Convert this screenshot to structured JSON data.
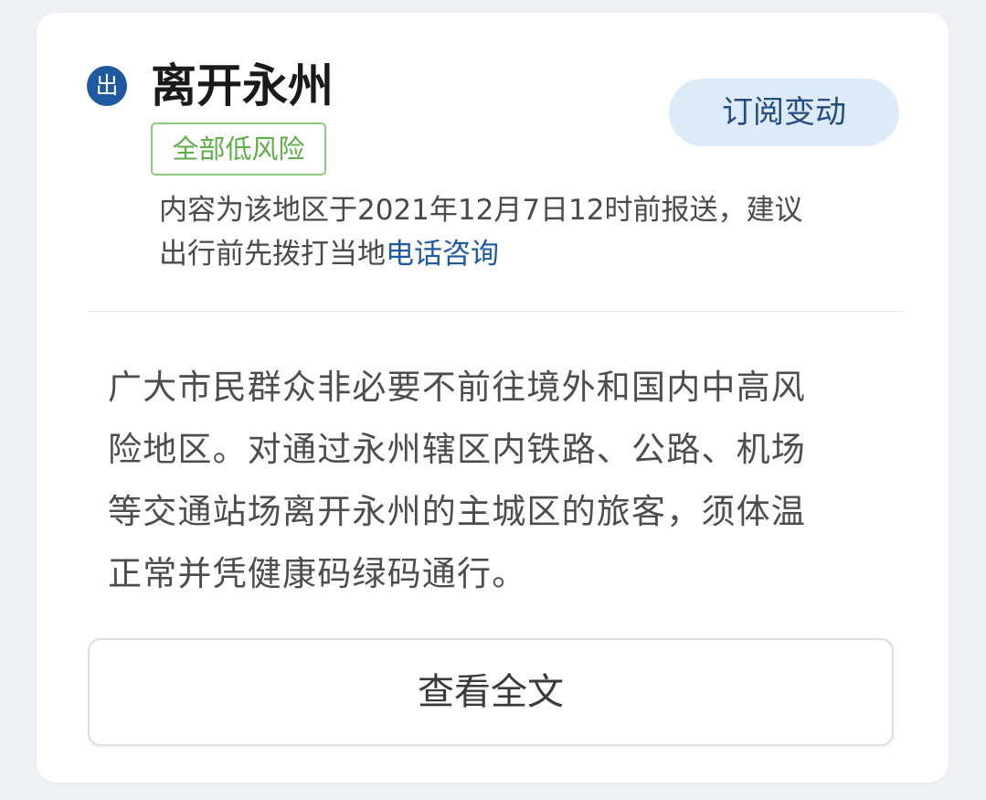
{
  "header": {
    "badge": "出",
    "title": "离开永州",
    "subscribe_label": "订阅变动"
  },
  "risk_tag": "全部低风险",
  "notice": {
    "line1": "内容为该地区于2021年12月7日12时前报送，建议",
    "line2_prefix": "出行前先拨打当地",
    "line2_link": "电话咨询"
  },
  "policy": {
    "lines": [
      "广大市民群众非必要不前往境外和国内中高风",
      "险地区。对通过永州辖区内铁路、公路、机场",
      "等交通站场离开永州的主城区的旅客，须体温",
      "正常并凭健康码绿码通行。"
    ]
  },
  "footer": {
    "view_full_label": "查看全文"
  },
  "colors": {
    "accent": "#1f5aa0",
    "subscribe_bg": "#ddebf8",
    "risk_green": "#5fae49",
    "page_bg": "#eef0f3"
  }
}
